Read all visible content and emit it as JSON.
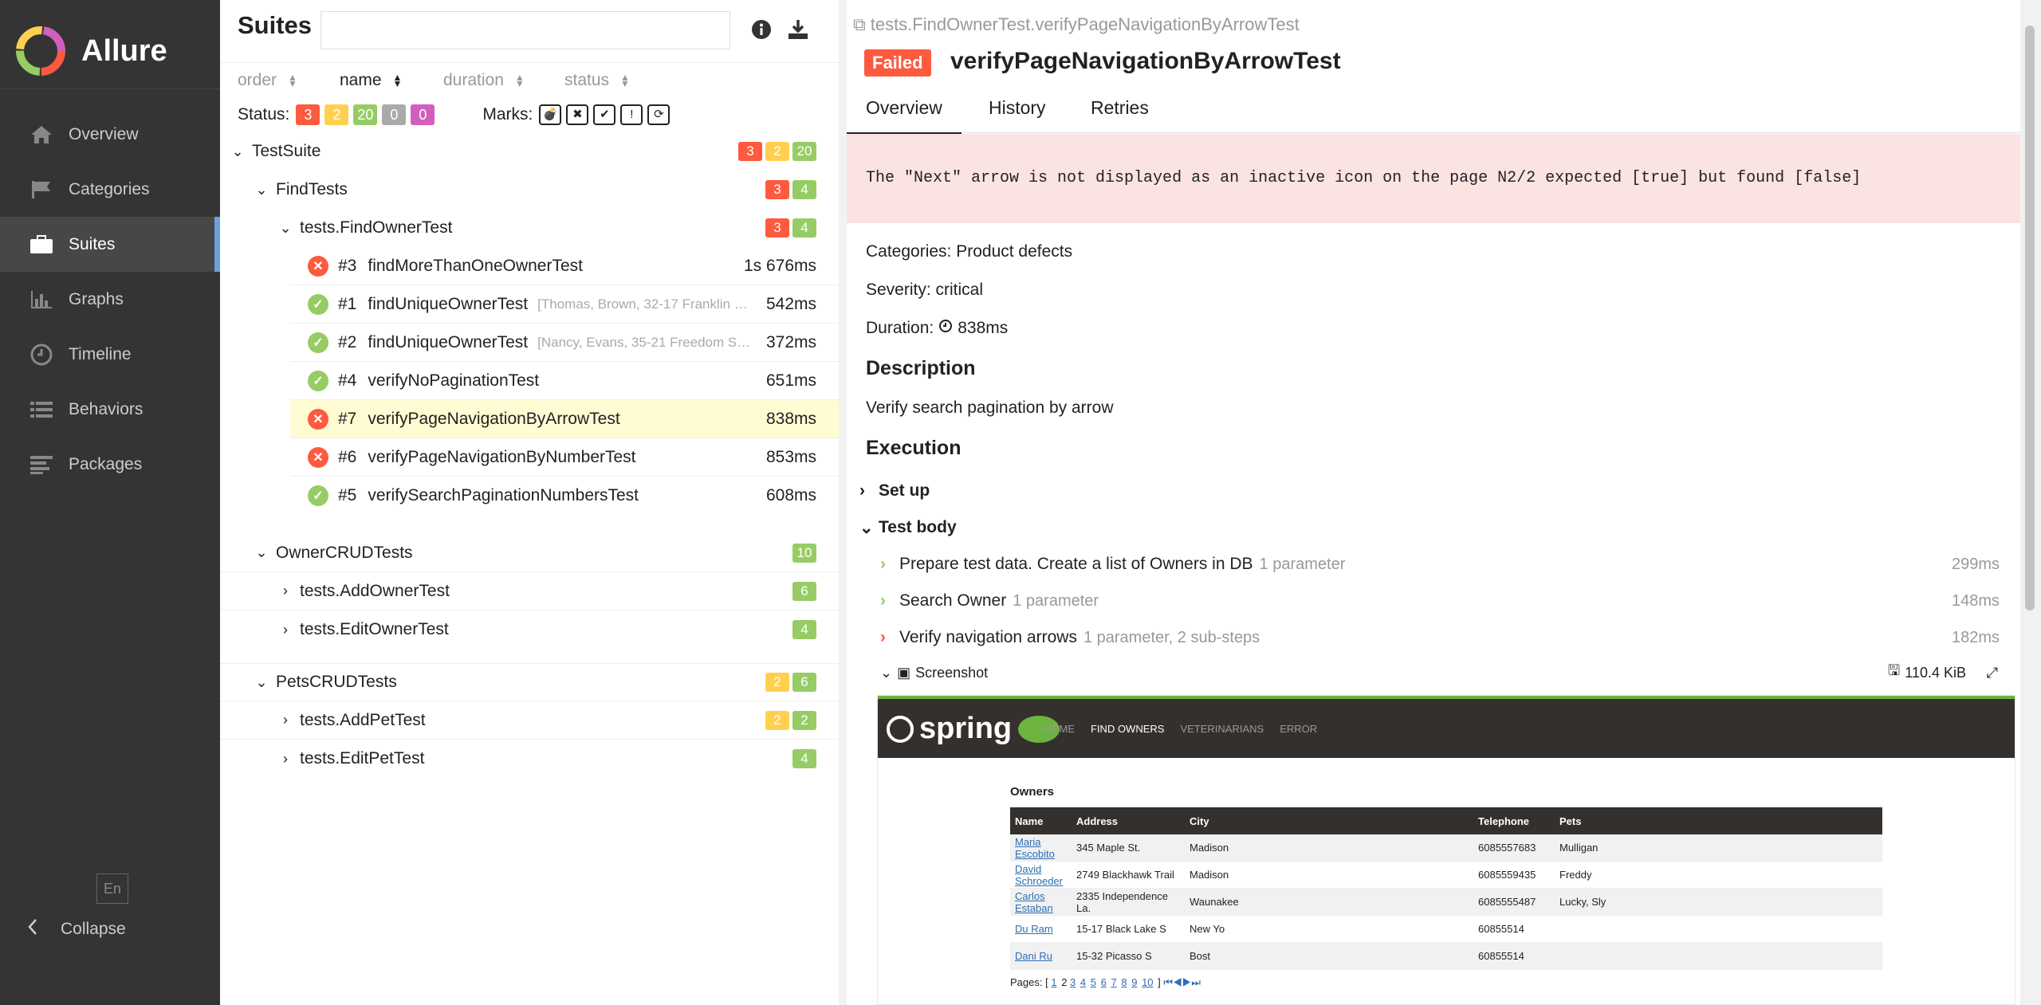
{
  "app": {
    "title": "Allure"
  },
  "nav": {
    "items": [
      {
        "label": "Overview",
        "icon": "home-icon"
      },
      {
        "label": "Categories",
        "icon": "flag-icon"
      },
      {
        "label": "Suites",
        "icon": "briefcase-icon"
      },
      {
        "label": "Graphs",
        "icon": "bar-chart-icon"
      },
      {
        "label": "Timeline",
        "icon": "clock-icon"
      },
      {
        "label": "Behaviors",
        "icon": "list-icon"
      },
      {
        "label": "Packages",
        "icon": "align-left-icon"
      }
    ],
    "active": "Suites",
    "lang": "En",
    "collapse": "Collapse"
  },
  "suites": {
    "title": "Suites",
    "search_placeholder": "",
    "sort": {
      "order": "order",
      "name": "name",
      "duration": "duration",
      "status": "status"
    },
    "status_label": "Status:",
    "status_counts": {
      "failed": "3",
      "broken": "2",
      "passed": "20",
      "skipped": "0",
      "unknown": "0"
    },
    "marks_label": "Marks:",
    "tree": {
      "testsuite": {
        "name": "TestSuite",
        "counts": [
          "3",
          "2",
          "20"
        ]
      },
      "findtests": {
        "name": "FindTests",
        "counts": [
          "3",
          "4"
        ]
      },
      "findowner": {
        "name": "tests.FindOwnerTest",
        "counts": [
          "3",
          "4"
        ]
      },
      "tests": [
        {
          "num": "#3",
          "name": "findMoreThanOneOwnerTest",
          "params": "",
          "dur": "1s 676ms",
          "status": "fail"
        },
        {
          "num": "#1",
          "name": "findUniqueOwnerTest",
          "params": "[Thomas, Brown, 32-17 Franklin …",
          "dur": "542ms",
          "status": "pass"
        },
        {
          "num": "#2",
          "name": "findUniqueOwnerTest",
          "params": "[Nancy, Evans, 35-21 Freedom S…",
          "dur": "372ms",
          "status": "pass"
        },
        {
          "num": "#4",
          "name": "verifyNoPaginationTest",
          "params": "",
          "dur": "651ms",
          "status": "pass"
        },
        {
          "num": "#7",
          "name": "verifyPageNavigationByArrowTest",
          "params": "",
          "dur": "838ms",
          "status": "fail"
        },
        {
          "num": "#6",
          "name": "verifyPageNavigationByNumberTest",
          "params": "",
          "dur": "853ms",
          "status": "fail"
        },
        {
          "num": "#5",
          "name": "verifySearchPaginationNumbersTest",
          "params": "",
          "dur": "608ms",
          "status": "pass"
        }
      ],
      "ownercrud": {
        "name": "OwnerCRUDTests",
        "counts": [
          "10"
        ]
      },
      "addowner": {
        "name": "tests.AddOwnerTest",
        "counts": [
          "6"
        ]
      },
      "editowner": {
        "name": "tests.EditOwnerTest",
        "counts": [
          "4"
        ]
      },
      "petscrud": {
        "name": "PetsCRUDTests",
        "counts": [
          "2",
          "6"
        ]
      },
      "addpet": {
        "name": "tests.AddPetTest",
        "counts": [
          "2",
          "2"
        ]
      },
      "editpet": {
        "name": "tests.EditPetTest",
        "counts": [
          "4"
        ]
      }
    }
  },
  "detail": {
    "breadcrumb": "tests.FindOwnerTest.verifyPageNavigationByArrowTest",
    "status": "Failed",
    "title": "verifyPageNavigationByArrowTest",
    "tabs": [
      "Overview",
      "History",
      "Retries"
    ],
    "error": "The \"Next\" arrow is not displayed as an inactive icon on the page N2/2 expected [true] but found [false]",
    "categories": "Categories: Product defects",
    "severity": "Severity: critical",
    "duration_label": "Duration:",
    "duration": "838ms",
    "description_title": "Description",
    "description": "Verify search pagination by arrow",
    "execution_title": "Execution",
    "setup": "Set up",
    "testbody": "Test body",
    "steps": [
      {
        "name": "Prepare test data. Create a list of Owners in DB",
        "sub": "1 parameter",
        "dur": "299ms",
        "status": "pass"
      },
      {
        "name": "Search Owner",
        "sub": "1 parameter",
        "dur": "148ms",
        "status": "pass"
      },
      {
        "name": "Verify navigation arrows",
        "sub": "1 parameter, 2 sub-steps",
        "dur": "182ms",
        "status": "fail"
      }
    ],
    "attachment": {
      "name": "Screenshot",
      "size": "110.4 KiB"
    },
    "screenshot": {
      "logo": "spring",
      "links": [
        "HOME",
        "FIND OWNERS",
        "VETERINARIANS",
        "ERROR"
      ],
      "owners_title": "Owners",
      "columns": [
        "Name",
        "Address",
        "City",
        "Telephone",
        "Pets"
      ],
      "rows": [
        [
          "Maria Escobito",
          "345 Maple St.",
          "Madison",
          "6085557683",
          "Mulligan"
        ],
        [
          "David Schroeder",
          "2749 Blackhawk Trail",
          "Madison",
          "6085559435",
          "Freddy"
        ],
        [
          "Carlos Estaban",
          "2335 Independence La.",
          "Waunakee",
          "6085555487",
          "Lucky, Sly"
        ],
        [
          "Du Ram",
          "15-17 Black Lake S",
          "New Yo",
          "60855514",
          ""
        ],
        [
          "Dani Ru",
          "15-32 Picasso S",
          "Bost",
          "60855514",
          ""
        ]
      ],
      "pages_label": "Pages: [",
      "pages": [
        "1",
        "2",
        "3",
        "4",
        "5",
        "6",
        "7",
        "8",
        "9",
        "10"
      ],
      "pages_end": "]"
    }
  },
  "colors": {
    "failed": "#fd5a3e",
    "broken": "#ffd050",
    "passed": "#97cc64",
    "skipped": "#aaaaaa",
    "unknown": "#d35ebe",
    "sidebar": "#343434",
    "accent": "#6d9fde"
  }
}
